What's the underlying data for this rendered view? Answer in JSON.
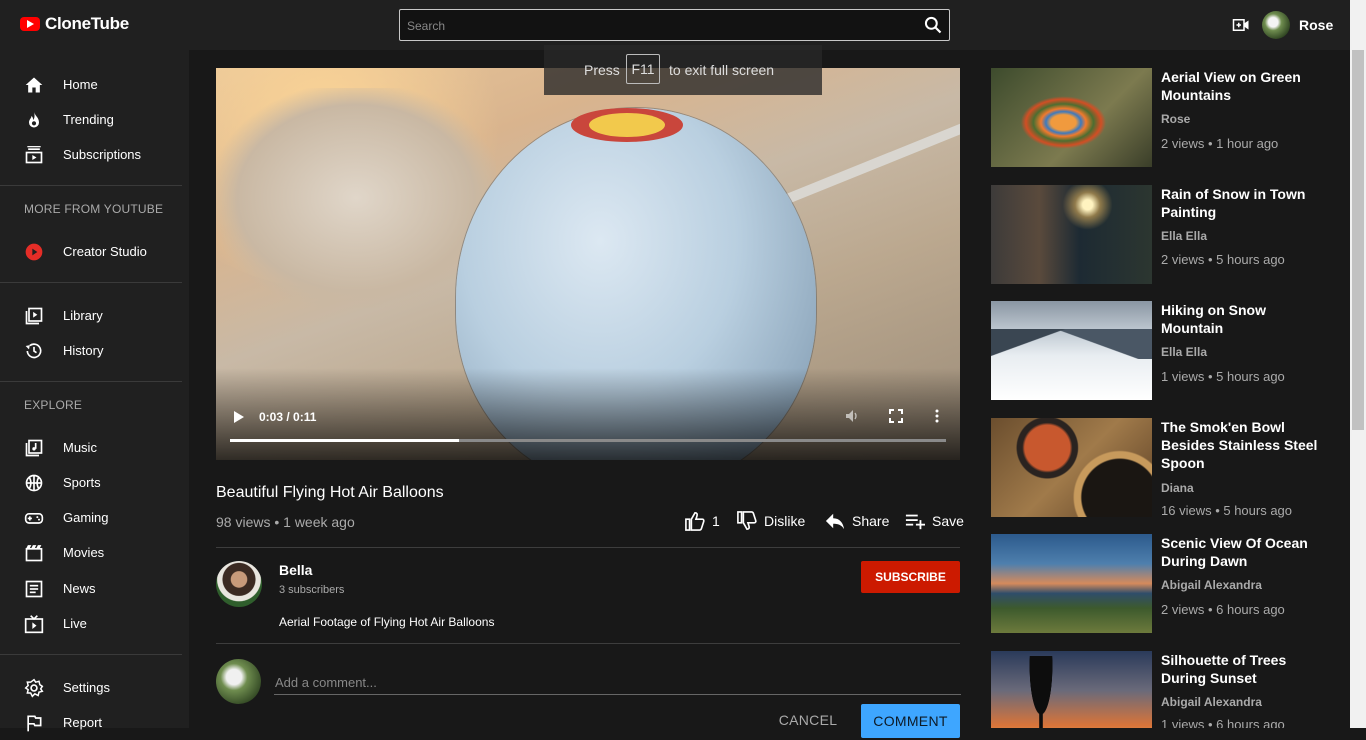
{
  "app": {
    "name": "CloneTube"
  },
  "header": {
    "search_placeholder": "Search",
    "username": "Rose"
  },
  "sidebar": {
    "main": [
      {
        "label": "Home",
        "icon": "home-icon"
      },
      {
        "label": "Trending",
        "icon": "flame-icon"
      },
      {
        "label": "Subscriptions",
        "icon": "subscriptions-icon"
      }
    ],
    "more_title": "MORE FROM YOUTUBE",
    "more": [
      {
        "label": "Creator Studio",
        "icon": "play-circle-icon"
      }
    ],
    "library": [
      {
        "label": "Library",
        "icon": "library-icon"
      },
      {
        "label": "History",
        "icon": "history-icon"
      }
    ],
    "explore_title": "EXPLORE",
    "explore": [
      {
        "label": "Music",
        "icon": "music-icon"
      },
      {
        "label": "Sports",
        "icon": "sports-icon"
      },
      {
        "label": "Gaming",
        "icon": "gaming-icon"
      },
      {
        "label": "Movies",
        "icon": "movies-icon"
      },
      {
        "label": "News",
        "icon": "news-icon"
      },
      {
        "label": "Live",
        "icon": "live-icon"
      }
    ],
    "footer": [
      {
        "label": "Settings",
        "icon": "gear-icon"
      },
      {
        "label": "Report",
        "icon": "flag-icon"
      }
    ]
  },
  "fullscreen_notice": {
    "press": "Press",
    "key": "F11",
    "message": "to exit full screen"
  },
  "player": {
    "time": "0:03 / 0:11",
    "progress": 0.32
  },
  "video": {
    "title": "Beautiful Flying Hot Air Balloons",
    "meta": "98 views • 1 week ago",
    "likes": "1",
    "dislike_label": "Dislike",
    "share_label": "Share",
    "save_label": "Save"
  },
  "channel": {
    "name": "Bella",
    "subscribers": "3 subscribers",
    "subscribe_label": "SUBSCRIBE",
    "description": "Aerial Footage of Flying Hot Air Balloons"
  },
  "comment_box": {
    "placeholder": "Add a comment...",
    "cancel_label": "CANCEL",
    "submit_label": "COMMENT"
  },
  "related": [
    {
      "title": "Aerial View on Green Mountains",
      "channel": "Rose",
      "meta": "2 views • 1 hour ago"
    },
    {
      "title": "Rain of Snow in Town Painting",
      "channel": "Ella Ella",
      "meta": "2 views • 5 hours ago"
    },
    {
      "title": "Hiking on Snow Mountain",
      "channel": "Ella Ella",
      "meta": "1 views • 5 hours ago"
    },
    {
      "title": "The Smok'en Bowl Besides Stainless Steel Spoon",
      "channel": "Diana",
      "meta": "16 views • 5 hours ago"
    },
    {
      "title": "Scenic View Of Ocean During Dawn",
      "channel": "Abigail Alexandra",
      "meta": "2 views • 6 hours ago"
    },
    {
      "title": "Silhouette of Trees During Sunset",
      "channel": "Abigail Alexandra",
      "meta": "1 views • 6 hours ago"
    }
  ],
  "colors": {
    "brand": "#ff0000",
    "subscribe": "#cc1a00",
    "comment_button": "#3ea6ff"
  }
}
